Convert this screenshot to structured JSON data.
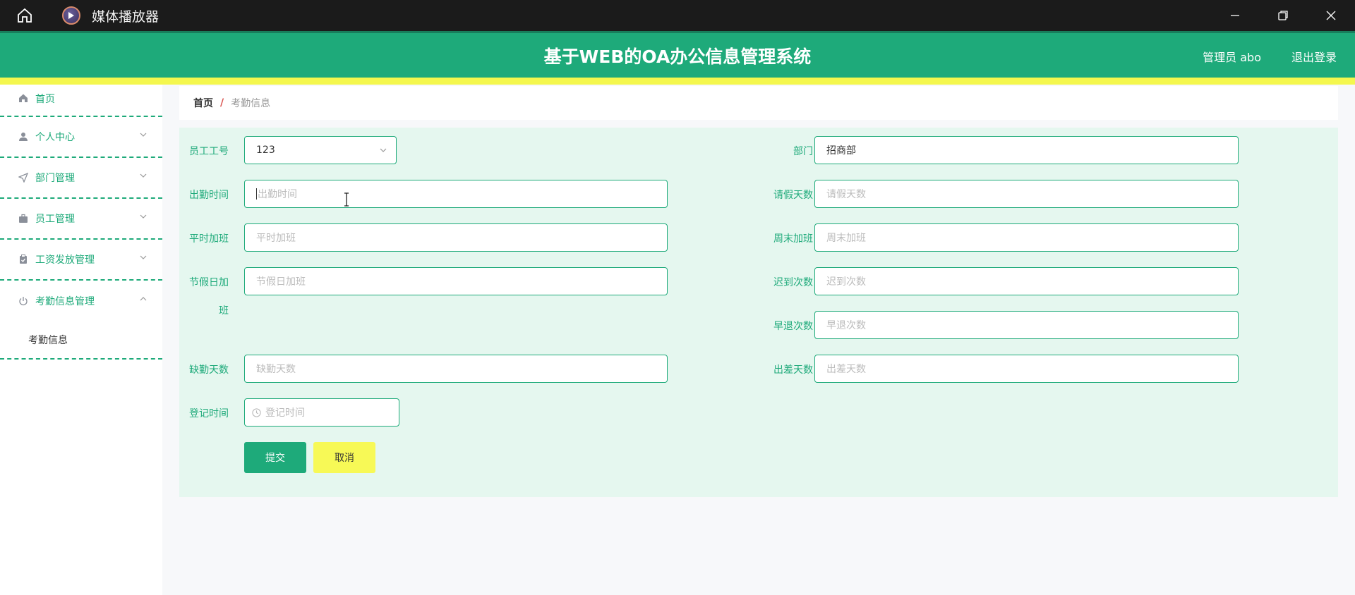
{
  "window": {
    "title": "媒体播放器"
  },
  "header": {
    "title": "基于WEB的OA办公信息管理系统",
    "user": "管理员 abo",
    "logout": "退出登录"
  },
  "sidebar": {
    "items": [
      {
        "label": "首页",
        "icon": "home-icon"
      },
      {
        "label": "个人中心",
        "icon": "user-icon"
      },
      {
        "label": "部门管理",
        "icon": "send-icon"
      },
      {
        "label": "员工管理",
        "icon": "briefcase-icon"
      },
      {
        "label": "工资发放管理",
        "icon": "clipboard-icon"
      },
      {
        "label": "考勤信息管理",
        "icon": "power-icon"
      }
    ],
    "sub_item": "考勤信息"
  },
  "breadcrumb": {
    "home": "首页",
    "separator": "/",
    "current": "考勤信息"
  },
  "form": {
    "employee_id": {
      "label": "员工工号",
      "value": "123"
    },
    "department": {
      "label": "部门",
      "value": "招商部"
    },
    "attendance_time": {
      "label": "出勤时间",
      "placeholder": "出勤时间"
    },
    "leave_days": {
      "label": "请假天数",
      "placeholder": "请假天数"
    },
    "weekday_overtime": {
      "label": "平时加班",
      "placeholder": "平时加班"
    },
    "weekend_overtime": {
      "label": "周末加班",
      "placeholder": "周末加班"
    },
    "holiday_overtime": {
      "label_line1": "节假日加",
      "label_line2": "班",
      "placeholder": "节假日加班"
    },
    "late_count": {
      "label": "迟到次数",
      "placeholder": "迟到次数"
    },
    "early_leave_count": {
      "label": "早退次数",
      "placeholder": "早退次数"
    },
    "absent_days": {
      "label": "缺勤天数",
      "placeholder": "缺勤天数"
    },
    "business_trip_days": {
      "label": "出差天数",
      "placeholder": "出差天数"
    },
    "register_time": {
      "label": "登记时间",
      "placeholder": "登记时间"
    },
    "submit": "提交",
    "cancel": "取消"
  },
  "colors": {
    "primary": "#1eaa7a",
    "accent": "#f4f74e",
    "panel": "#e5f7ef"
  }
}
